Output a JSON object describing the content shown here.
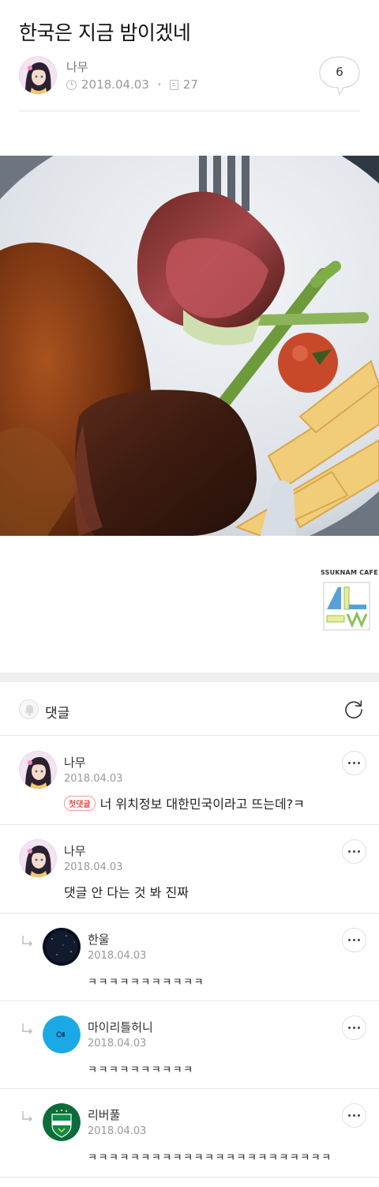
{
  "post": {
    "title": "한국은 지금 밤이겠네",
    "author": "나무",
    "date": "2018.04.03",
    "views": "27",
    "comment_count": "6"
  },
  "image": {
    "description_icon": "steak-photo",
    "watermark": "SSUKNAM CAFE"
  },
  "comments_section": {
    "label": "댓글"
  },
  "comments": [
    {
      "author": "나무",
      "date": "2018.04.03",
      "badge": "첫댓글",
      "text": "너 위치정보 대한민국이라고 뜨는데?ㅋ"
    },
    {
      "author": "나무",
      "date": "2018.04.03",
      "text": "댓글 안 다는 것 봐 진짜"
    },
    {
      "author": "한울",
      "date": "2018.04.03",
      "text": "ㅋㅋㅋㅋㅋㅋㅋㅋㅋㅋㅋ"
    },
    {
      "author": "마이리틀허니",
      "date": "2018.04.03",
      "text": "ㅋㅋㅋㅋㅋㅋㅋㅋㅋㅋ"
    },
    {
      "author": "리버풀",
      "date": "2018.04.03",
      "text": "ㅋㅋㅋㅋㅋㅋㅋㅋㅋㅋㅋㅋㅋㅋㅋㅋㅋㅋㅋㅋㅋㅋㅋ"
    }
  ],
  "colors": {
    "accent_red": "#e84a4a",
    "divider": "#e8e8e8",
    "section_gap": "#eeeef0"
  }
}
